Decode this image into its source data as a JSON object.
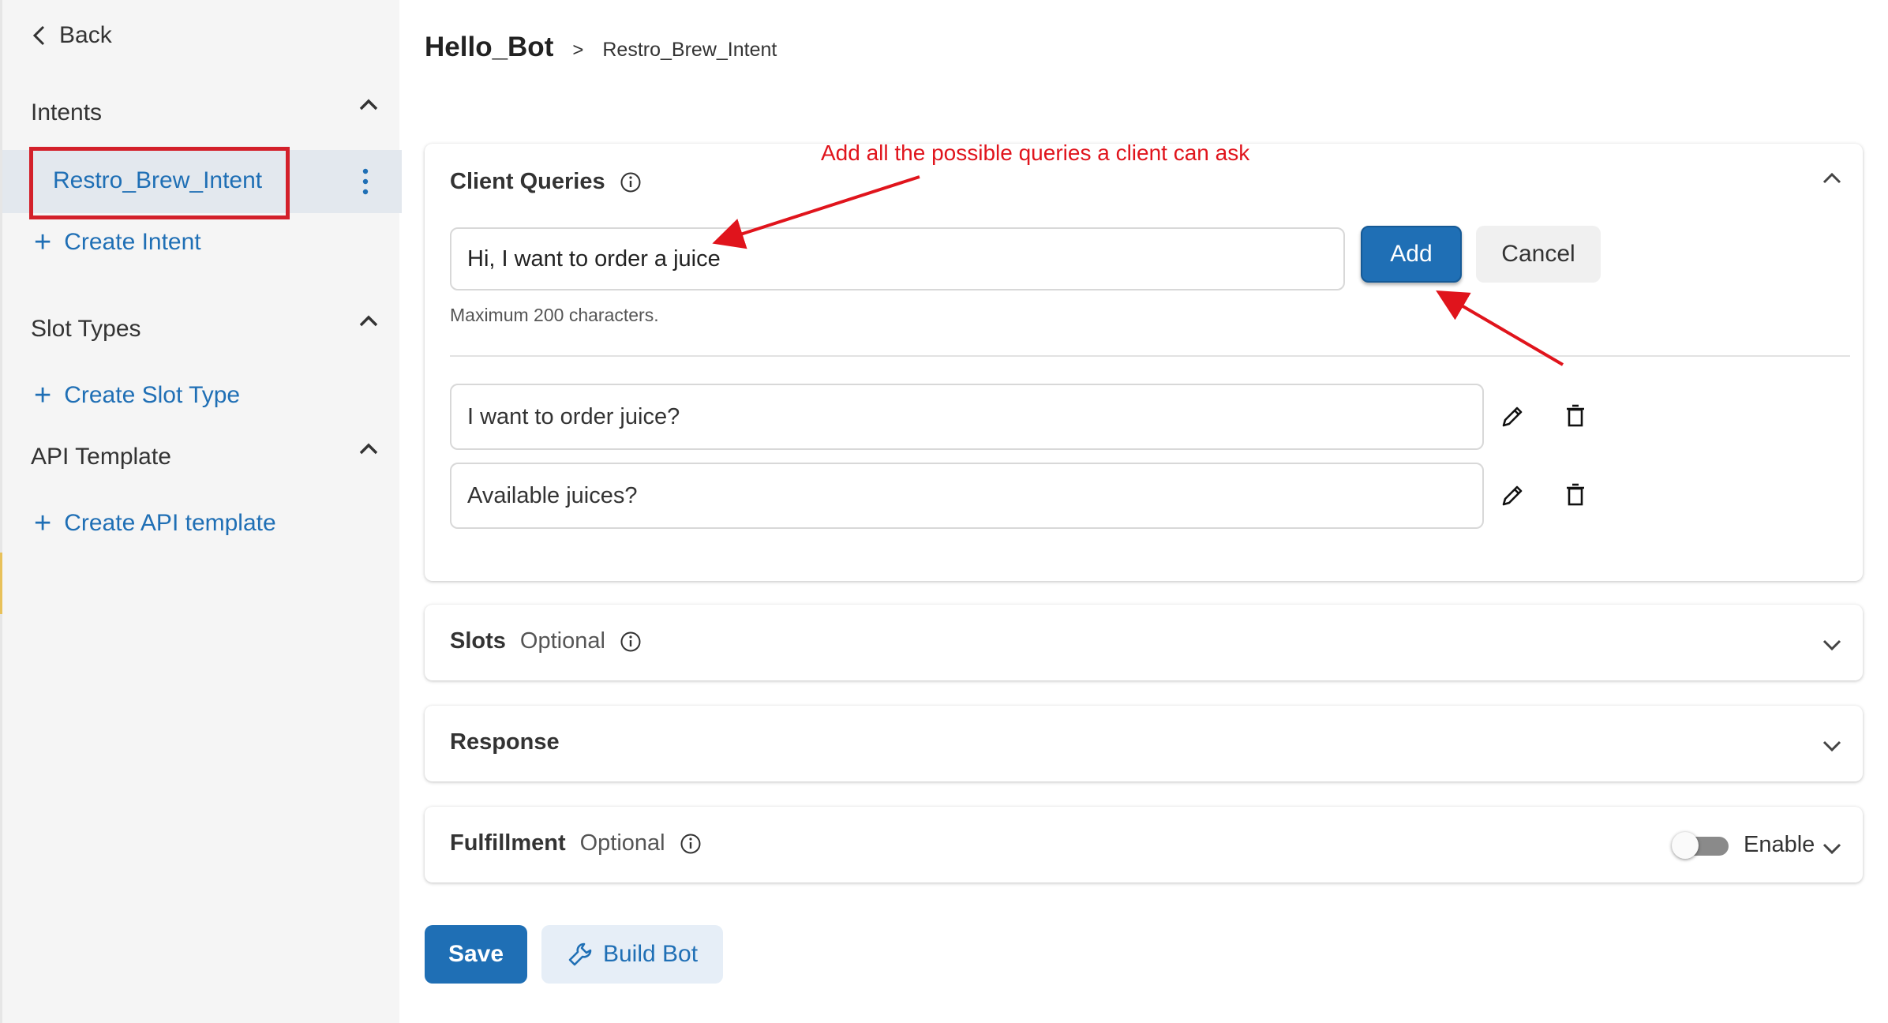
{
  "sidebar": {
    "back_label": "Back",
    "intents": {
      "title": "Intents",
      "items": [
        {
          "label": "Restro_Brew_Intent"
        }
      ],
      "create_label": "Create Intent"
    },
    "slot_types": {
      "title": "Slot Types",
      "create_label": "Create Slot Type"
    },
    "api_template": {
      "title": "API Template",
      "create_label": "Create API template"
    }
  },
  "breadcrumb": {
    "bot": "Hello_Bot",
    "separator": ">",
    "intent": "Restro_Brew_Intent"
  },
  "client_queries": {
    "title": "Client Queries",
    "input_value": "Hi, I want to order a juice",
    "add_label": "Add",
    "cancel_label": "Cancel",
    "hint": "Maximum 200 characters.",
    "items": [
      {
        "text": "I want to order juice?"
      },
      {
        "text": "Available juices?"
      }
    ]
  },
  "slots": {
    "title": "Slots",
    "optional": "Optional"
  },
  "response": {
    "title": "Response"
  },
  "fulfillment": {
    "title": "Fulfillment",
    "optional": "Optional",
    "toggle_label": "Enable",
    "enabled": false
  },
  "actions": {
    "save_label": "Save",
    "build_label": "Build Bot"
  },
  "annotation": {
    "text": "Add all the possible queries a client can ask",
    "color": "#e0141c"
  },
  "colors": {
    "accent": "#1f6fb5",
    "highlight": "#d3202a",
    "sidebar_bg": "#f5f5f5"
  }
}
